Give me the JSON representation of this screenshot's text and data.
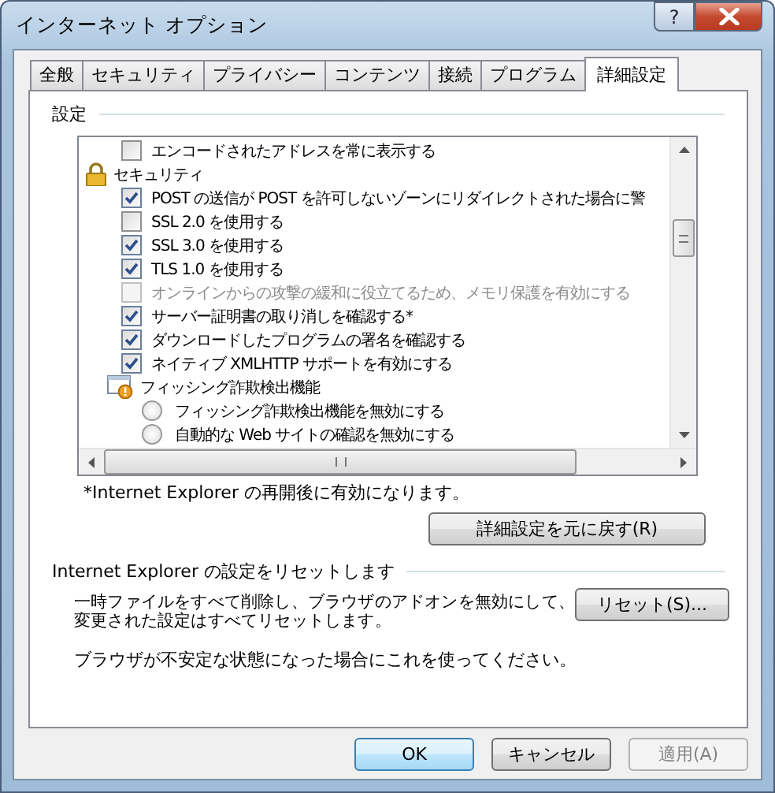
{
  "window": {
    "title": "インターネット オプション",
    "help_button": "?"
  },
  "tabs": [
    {
      "label": "全般",
      "selected": false
    },
    {
      "label": "セキュリティ",
      "selected": false
    },
    {
      "label": "プライバシー",
      "selected": false
    },
    {
      "label": "コンテンツ",
      "selected": false
    },
    {
      "label": "接続",
      "selected": false
    },
    {
      "label": "プログラム",
      "selected": false
    },
    {
      "label": "詳細設定",
      "selected": true
    }
  ],
  "settings": {
    "label": "設定",
    "items": [
      {
        "kind": "checkbox",
        "label": "エンコードされたアドレスを常に表示する",
        "checked": false,
        "disabled": false
      },
      {
        "kind": "category",
        "label": "セキュリティ"
      },
      {
        "kind": "checkbox",
        "label": "POST の送信が POST を許可しないゾーンにリダイレクトされた場合に警",
        "checked": true,
        "disabled": false
      },
      {
        "kind": "checkbox",
        "label": "SSL 2.0 を使用する",
        "checked": false,
        "disabled": false
      },
      {
        "kind": "checkbox",
        "label": "SSL 3.0 を使用する",
        "checked": true,
        "disabled": false
      },
      {
        "kind": "checkbox",
        "label": "TLS 1.0 を使用する",
        "checked": true,
        "disabled": false
      },
      {
        "kind": "checkbox",
        "label": "オンラインからの攻撃の緩和に役立てるため、メモリ保護を有効にする",
        "checked": false,
        "disabled": true
      },
      {
        "kind": "checkbox",
        "label": "サーバー証明書の取り消しを確認する*",
        "checked": true,
        "disabled": false
      },
      {
        "kind": "checkbox",
        "label": "ダウンロードしたプログラムの署名を確認する",
        "checked": true,
        "disabled": false
      },
      {
        "kind": "checkbox",
        "label": "ネイティブ XMLHTTP サポートを有効にする",
        "checked": true,
        "disabled": false
      },
      {
        "kind": "subcategory",
        "label": "フィッシング詐欺検出機能"
      },
      {
        "kind": "radio",
        "label": "フィッシング詐欺検出機能を無効にする",
        "selected": false
      },
      {
        "kind": "radio",
        "label": "自動的な Web サイトの確認を無効にする",
        "selected": false
      }
    ],
    "note": "*Internet Explorer の再開後に有効になります。",
    "restore_button": "詳細設定を元に戻す(R)"
  },
  "reset": {
    "label": "Internet Explorer の設定をリセットします",
    "description_lines": [
      "一時ファイルをすべて削除し、ブラウザのアドオンを無効にして、",
      "変更された設定はすべてリセットします。"
    ],
    "button": "リセット(S)...",
    "hint": "ブラウザが不安定な状態になった場合にこれを使ってください。"
  },
  "buttons": [
    {
      "label": "OK",
      "default": true,
      "disabled": false
    },
    {
      "label": "キャンセル",
      "default": false,
      "disabled": false
    },
    {
      "label": "適用(A)",
      "default": false,
      "disabled": true
    }
  ]
}
